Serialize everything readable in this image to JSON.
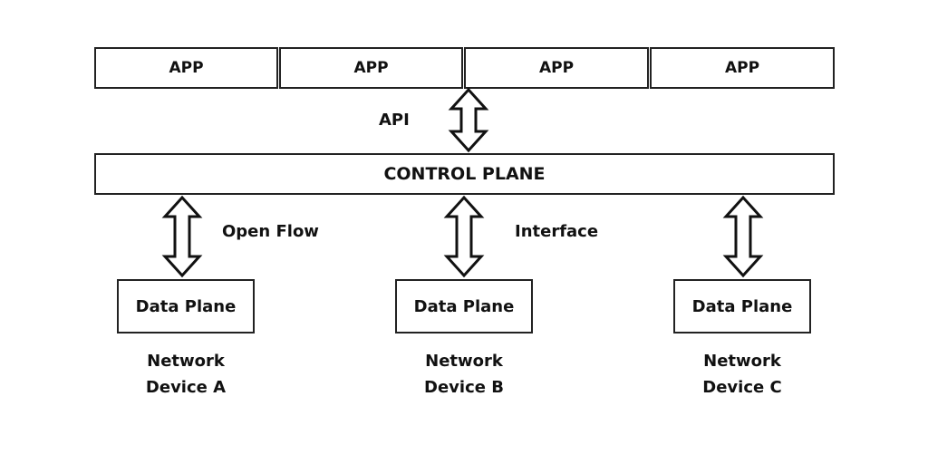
{
  "apps": [
    "APP",
    "APP",
    "APP",
    "APP"
  ],
  "api_label": "API",
  "control_plane": "CONTROL PLANE",
  "openflow_label": "Open Flow",
  "interface_label": "Interface",
  "devices": [
    {
      "plane": "Data Plane",
      "line1": "Network",
      "line2": "Device A"
    },
    {
      "plane": "Data Plane",
      "line1": "Network",
      "line2": "Device B"
    },
    {
      "plane": "Data Plane",
      "line1": "Network",
      "line2": "Device C"
    }
  ]
}
